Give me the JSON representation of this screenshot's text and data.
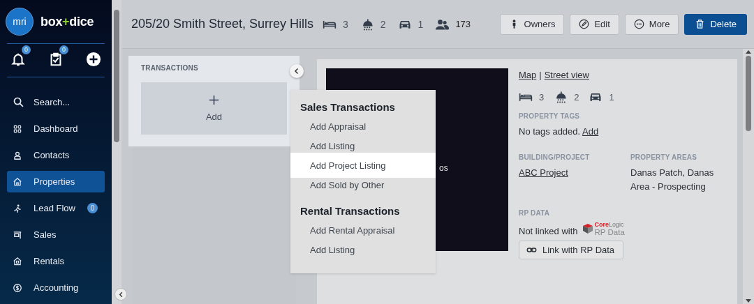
{
  "brand": {
    "badge": "mri",
    "name_left": "box",
    "name_plus": "+",
    "name_right": "dice"
  },
  "toolbar": [
    {
      "kind": "bell",
      "badge": "0"
    },
    {
      "kind": "tasks",
      "badge": "0"
    },
    {
      "kind": "add"
    }
  ],
  "nav": [
    {
      "kind": "search",
      "label": "Search...",
      "selected": false
    },
    {
      "kind": "grid",
      "label": "Dashboard",
      "selected": false
    },
    {
      "kind": "person",
      "label": "Contacts",
      "selected": false
    },
    {
      "kind": "house",
      "label": "Properties",
      "selected": true
    },
    {
      "kind": "lead",
      "label": "Lead Flow",
      "selected": false,
      "badge": "0"
    },
    {
      "kind": "sign",
      "label": "Sales",
      "selected": false
    },
    {
      "kind": "rental",
      "label": "Rentals",
      "selected": false
    },
    {
      "kind": "coin",
      "label": "Accounting",
      "selected": false
    }
  ],
  "header": {
    "title": "205/20 Smith Street, Surrey Hills",
    "stats": [
      {
        "kind": "bed",
        "value": "3"
      },
      {
        "kind": "shower",
        "value": "2"
      },
      {
        "kind": "car",
        "value": "1"
      },
      {
        "kind": "people",
        "value": "173"
      }
    ],
    "buttons": [
      {
        "kind": "owner",
        "label": "Owners"
      },
      {
        "kind": "edit",
        "label": "Edit"
      },
      {
        "kind": "more",
        "label": "More"
      },
      {
        "kind": "delete",
        "label": "Delete"
      }
    ]
  },
  "transactions": {
    "title": "TRANSACTIONS",
    "add_label": "Add"
  },
  "menu": {
    "sections": [
      {
        "title": "Sales Transactions",
        "items": [
          {
            "label": "Add Appraisal",
            "selected": false
          },
          {
            "label": "Add Listing",
            "selected": false
          },
          {
            "label": "Add Project Listing",
            "selected": true
          },
          {
            "label": "Add Sold by Other",
            "selected": false
          }
        ]
      },
      {
        "title": "Rental Transactions",
        "items": [
          {
            "label": "Add Rental Appraisal",
            "selected": false
          },
          {
            "label": "Add Listing",
            "selected": false
          }
        ]
      }
    ]
  },
  "photo": {
    "text": "os"
  },
  "details": {
    "links": [
      "Map",
      "Street view"
    ],
    "separator": "|",
    "stats": [
      {
        "kind": "bed",
        "value": "3"
      },
      {
        "kind": "shower",
        "value": "2"
      },
      {
        "kind": "car",
        "value": "1"
      }
    ],
    "tags": {
      "heading": "PROPERTY TAGS",
      "text": "No tags added.",
      "link": "Add"
    },
    "building": {
      "heading": "BUILDING/PROJECT",
      "link": "ABC Project"
    },
    "areas": {
      "heading": "PROPERTY AREAS",
      "text": "Danas Patch, Danas Area - Prospecting"
    },
    "rp": {
      "heading": "RP DATA",
      "text": "Not linked with",
      "logo_core": "Core",
      "logo_logic": "Logic",
      "logo_sub": "RP Data",
      "button": "Link with RP Data"
    }
  }
}
